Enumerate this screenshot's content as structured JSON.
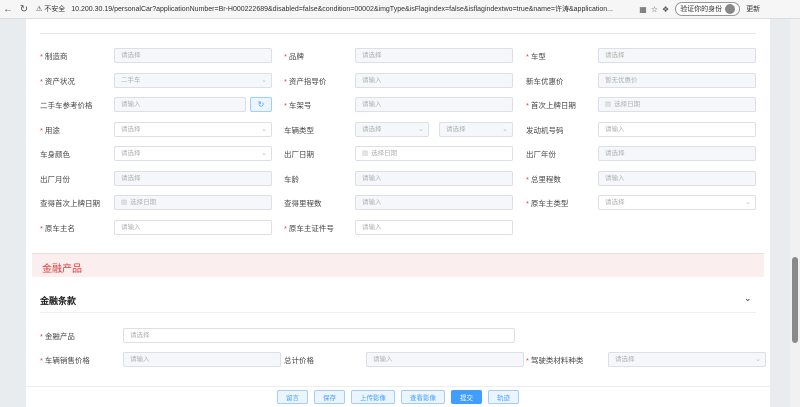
{
  "browser": {
    "insecure_label": "不安全",
    "url": "10.200.30.19/personalCar?applicationNumber=Br-H000222689&disabled=false&condition=00002&imgType&isFlagindex=false&isflagindextwo=true&name=许涛&application...",
    "verify_label": "验证你的身份",
    "update_label": "更新"
  },
  "rows": [
    {
      "fields": [
        {
          "label": "制造商",
          "required": true,
          "placeholder": "请选择",
          "disabled": true,
          "arrow": false
        },
        {
          "label": "品牌",
          "required": true,
          "placeholder": "请选择",
          "disabled": true,
          "arrow": false
        },
        {
          "label": "车型",
          "required": true,
          "placeholder": "请选择",
          "disabled": true,
          "arrow": false
        }
      ]
    },
    {
      "fields": [
        {
          "label": "资产状况",
          "required": true,
          "placeholder": "二手车",
          "disabled": true,
          "arrow": true
        },
        {
          "label": "资产指导价",
          "required": true,
          "placeholder": "请输入",
          "disabled": true,
          "arrow": false
        },
        {
          "label": "新车优惠价",
          "required": false,
          "placeholder": "暂无优惠价",
          "disabled": true,
          "arrow": false
        }
      ]
    },
    {
      "fields": [
        {
          "label": "二手车参考价格",
          "required": false,
          "placeholder": "请输入",
          "disabled": true,
          "arrow": false,
          "refresh": true
        },
        {
          "label": "车架号",
          "required": true,
          "placeholder": "请输入",
          "disabled": true,
          "arrow": false
        },
        {
          "label": "首次上牌日期",
          "required": true,
          "placeholder": "选择日期",
          "disabled": true,
          "arrow": false,
          "date": true
        }
      ]
    },
    {
      "fields": [
        {
          "label": "用途",
          "required": true,
          "placeholder": "请选择",
          "disabled": false,
          "arrow": true
        },
        {
          "label": "车辆类型",
          "required": false,
          "placeholder": "请选择",
          "disabled": true,
          "arrow": true,
          "split": "请选择"
        },
        {
          "label": "发动机号码",
          "required": false,
          "placeholder": "请输入",
          "disabled": false,
          "arrow": false
        }
      ]
    },
    {
      "fields": [
        {
          "label": "车身颜色",
          "required": false,
          "placeholder": "请选择",
          "disabled": false,
          "arrow": true
        },
        {
          "label": "出厂日期",
          "required": false,
          "placeholder": "选择日期",
          "disabled": false,
          "arrow": false,
          "date": true
        },
        {
          "label": "出厂年份",
          "required": false,
          "placeholder": "请选择",
          "disabled": true,
          "arrow": false
        }
      ]
    },
    {
      "fields": [
        {
          "label": "出厂月份",
          "required": false,
          "placeholder": "请选择",
          "disabled": true,
          "arrow": false
        },
        {
          "label": "车龄",
          "required": false,
          "placeholder": "请输入",
          "disabled": true,
          "arrow": false
        },
        {
          "label": "总里程数",
          "required": true,
          "placeholder": "请输入",
          "disabled": true,
          "arrow": false
        }
      ]
    },
    {
      "fields": [
        {
          "label": "查得首次上牌日期",
          "required": false,
          "placeholder": "选择日期",
          "disabled": true,
          "arrow": false,
          "date": true
        },
        {
          "label": "查得里程数",
          "required": false,
          "placeholder": "请输入",
          "disabled": true,
          "arrow": false
        },
        {
          "label": "原车主类型",
          "required": true,
          "placeholder": "请选择",
          "disabled": false,
          "arrow": true
        }
      ]
    },
    {
      "fields": [
        {
          "label": "原车主名",
          "required": true,
          "placeholder": "请输入",
          "disabled": false,
          "arrow": false
        },
        {
          "label": "原车主证件号",
          "required": true,
          "placeholder": "请输入",
          "disabled": false,
          "arrow": false
        }
      ]
    }
  ],
  "finance_section_title": "金融产品",
  "terms_title": "金融条款",
  "finance_rows": [
    {
      "fields": [
        {
          "label": "金融产品",
          "required": true,
          "placeholder": "请选择",
          "disabled": false,
          "arrow": false,
          "wide": true
        }
      ]
    },
    {
      "fields": [
        {
          "label": "车辆销售价格",
          "required": true,
          "placeholder": "请输入",
          "disabled": true,
          "arrow": false
        },
        {
          "label": "总计价格",
          "required": false,
          "placeholder": "请输入",
          "disabled": true,
          "arrow": false
        },
        {
          "label": "驾驶类材料种类",
          "required": true,
          "placeholder": "请选择",
          "disabled": true,
          "arrow": true
        }
      ]
    }
  ],
  "footer_buttons": [
    {
      "label": "留言",
      "primary": false
    },
    {
      "label": "保存",
      "primary": false
    },
    {
      "label": "上传影像",
      "primary": false
    },
    {
      "label": "查看影像",
      "primary": false
    },
    {
      "label": "提交",
      "primary": true
    },
    {
      "label": "轨迹",
      "primary": false
    }
  ]
}
